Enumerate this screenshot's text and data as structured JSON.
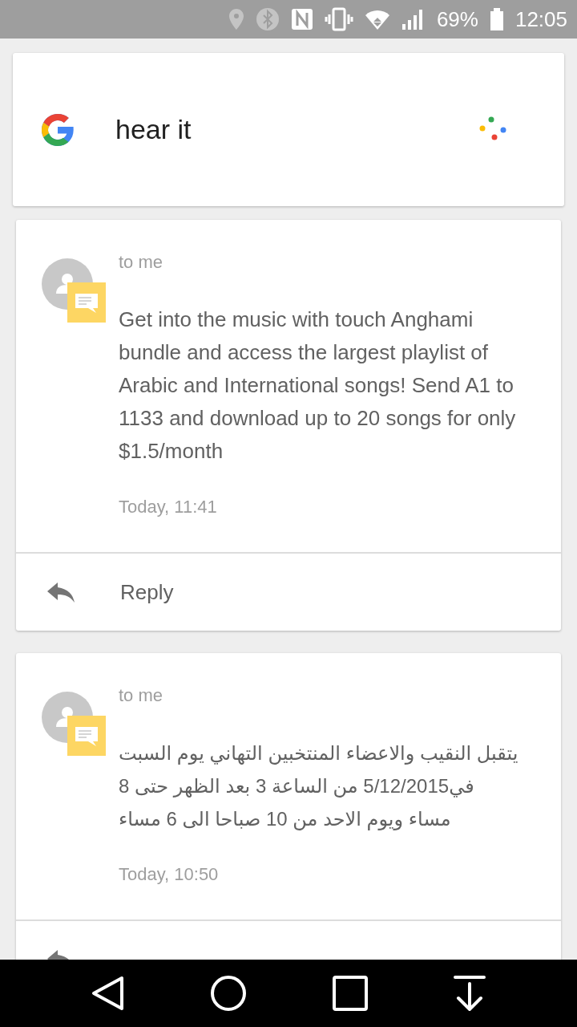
{
  "status_bar": {
    "battery": "69%",
    "time": "12:05"
  },
  "search_card": {
    "query": "hear it"
  },
  "messages": [
    {
      "recipient": "to me",
      "body": "Get into the music with touch Anghami bundle and access the largest playlist of Arabic and International songs! Send A1 to 1133 and download up to 20 songs for only $1.5/month",
      "kind": "latin",
      "time": "Today, 11:41",
      "reply_label": "Reply"
    },
    {
      "recipient": "to me",
      "body": "يتقبل النقيب والاعضاء المنتخبين التهاني يوم السبت في5/12/2015 من الساعة 3 بعد الظهر حتى 8 مساء ويوم الاحد من 10 صباحا الى 6 مساء",
      "kind": "arabic",
      "time": "Today, 10:50"
    }
  ]
}
